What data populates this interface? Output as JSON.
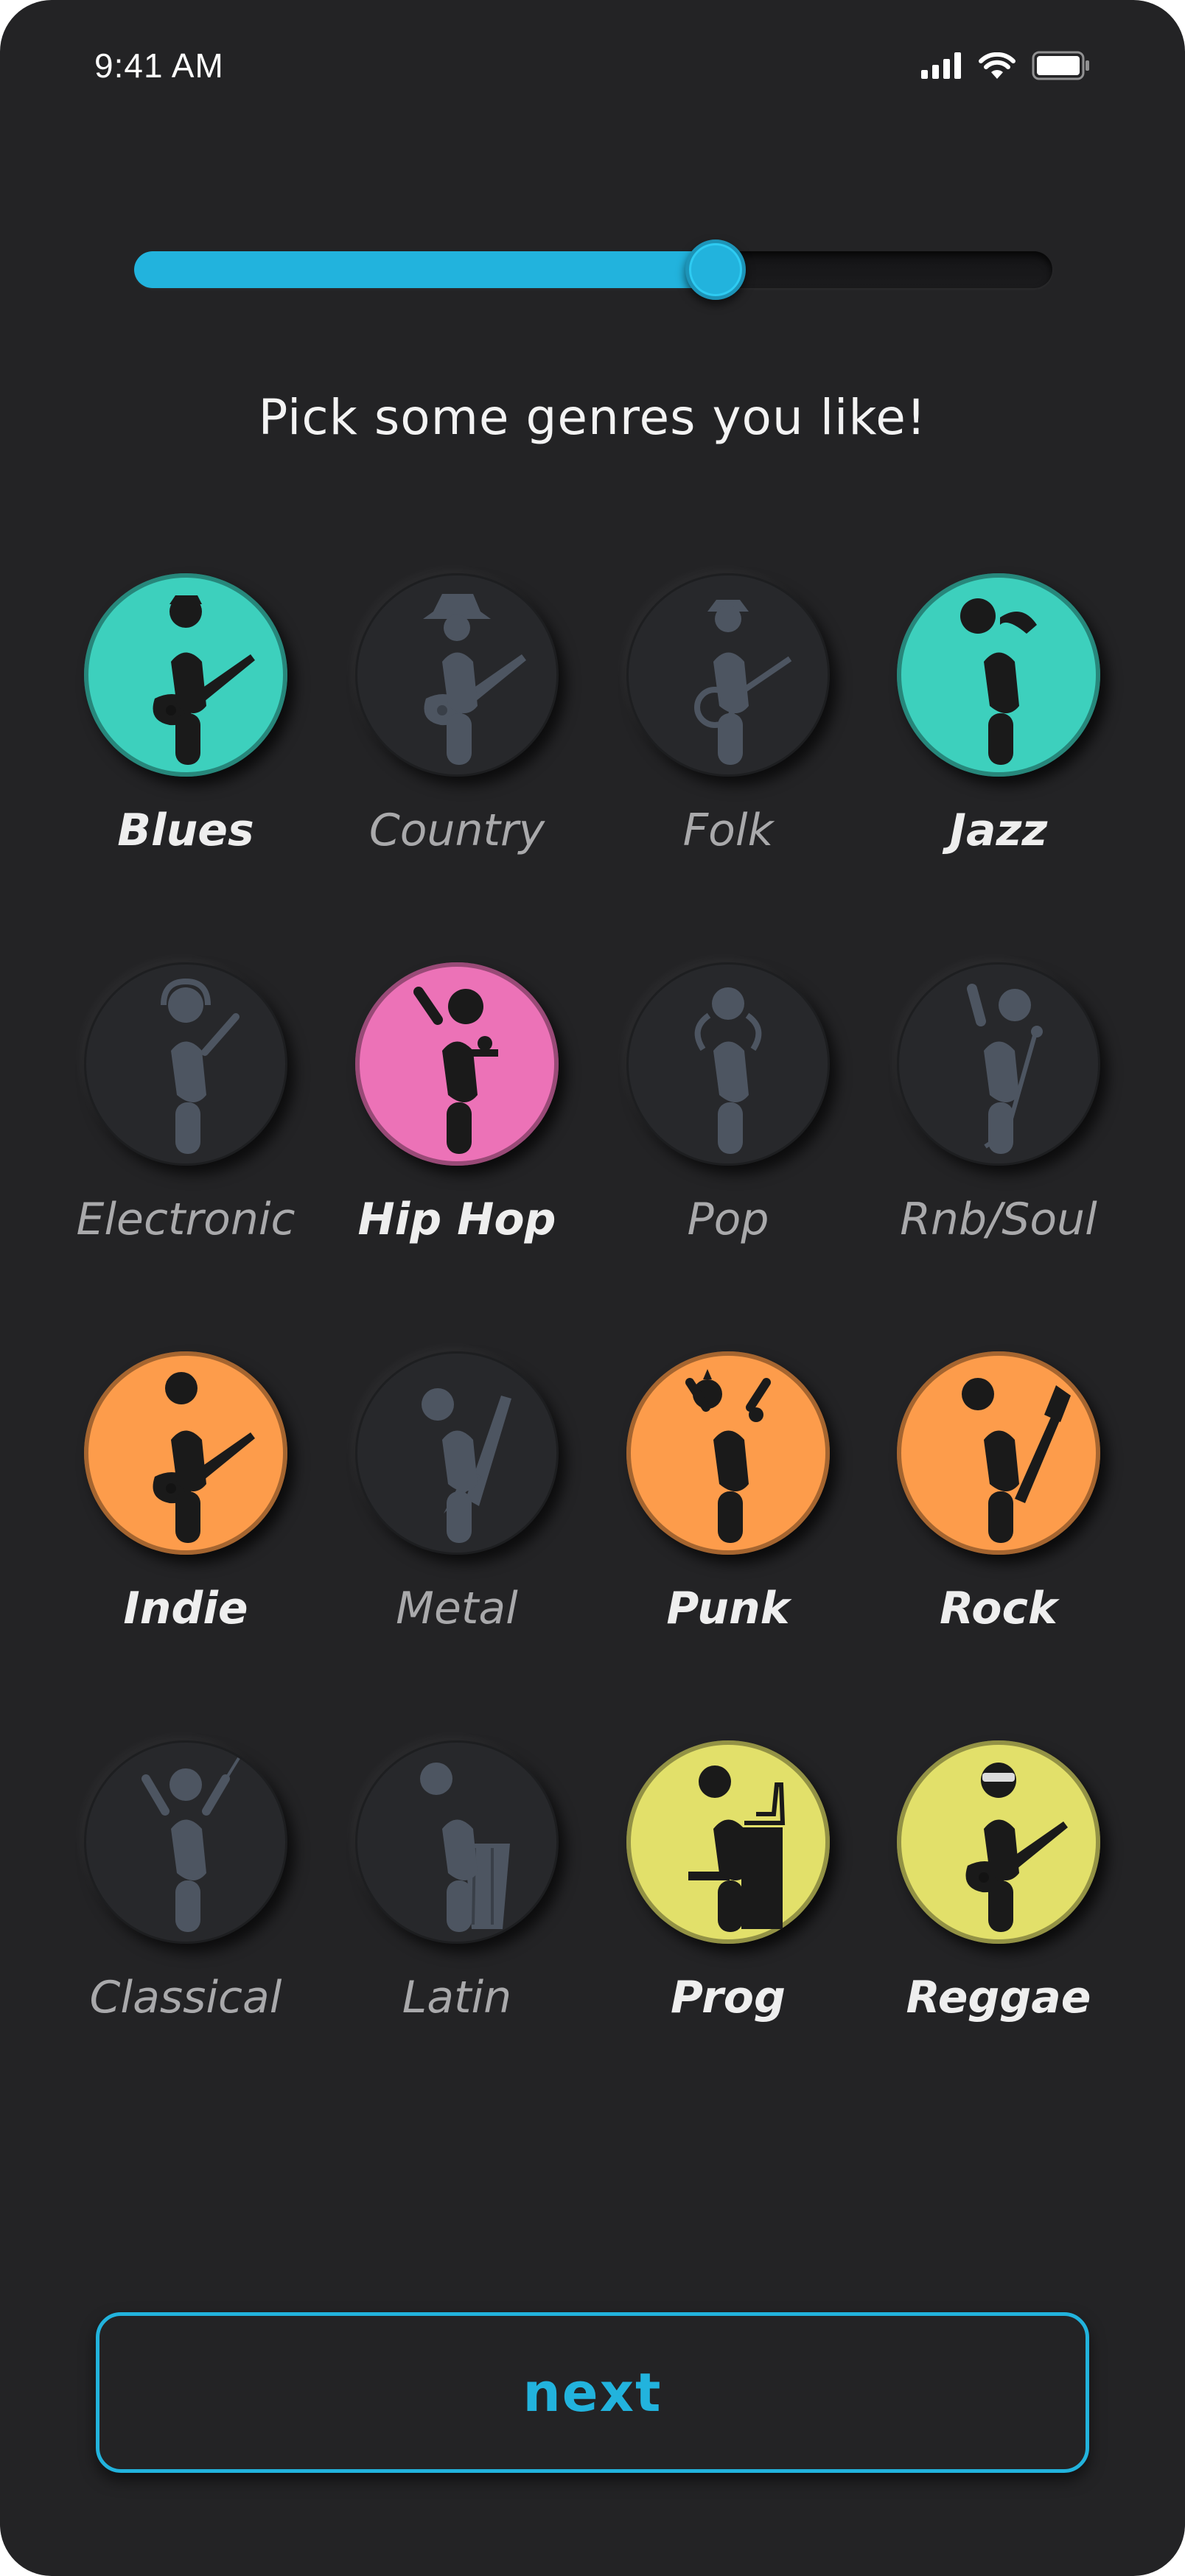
{
  "status_bar": {
    "time": "9:41 AM",
    "icons": [
      "signal-icon",
      "wifi-icon",
      "battery-icon"
    ]
  },
  "progress": {
    "value": 0.64,
    "fill_color": "#22b3dd"
  },
  "heading": "Pick some genres you like!",
  "colors": {
    "teal": "#3dd0bd",
    "pink": "#ec72b7",
    "orange": "#fd9c4b",
    "yellow": "#e2e06a",
    "unselected_figure": "#4d5561",
    "selected_figure": "#1a1a1a",
    "accent": "#22b3dd"
  },
  "genres": [
    {
      "label": "Blues",
      "selected": true,
      "color": "#3dd0bd",
      "icon": "guitarist-icon"
    },
    {
      "label": "Country",
      "selected": false,
      "color": "",
      "icon": "cowboy-guitarist-icon"
    },
    {
      "label": "Folk",
      "selected": false,
      "color": "",
      "icon": "banjo-player-icon"
    },
    {
      "label": "Jazz",
      "selected": true,
      "color": "#3dd0bd",
      "icon": "saxophonist-icon"
    },
    {
      "label": "Electronic",
      "selected": false,
      "color": "",
      "icon": "dj-headphones-icon"
    },
    {
      "label": "Hip Hop",
      "selected": true,
      "color": "#ec72b7",
      "icon": "rapper-icon"
    },
    {
      "label": "Pop",
      "selected": false,
      "color": "",
      "icon": "pop-singer-icon"
    },
    {
      "label": "Rnb/Soul",
      "selected": false,
      "color": "",
      "icon": "mic-stand-singer-icon"
    },
    {
      "label": "Indie",
      "selected": true,
      "color": "#fd9c4b",
      "icon": "indie-guitarist-icon"
    },
    {
      "label": "Metal",
      "selected": false,
      "color": "",
      "icon": "metal-guitarist-icon"
    },
    {
      "label": "Punk",
      "selected": true,
      "color": "#fd9c4b",
      "icon": "punk-singer-icon"
    },
    {
      "label": "Rock",
      "selected": true,
      "color": "#fd9c4b",
      "icon": "rock-guitarist-icon"
    },
    {
      "label": "Classical",
      "selected": false,
      "color": "",
      "icon": "conductor-icon"
    },
    {
      "label": "Latin",
      "selected": false,
      "color": "",
      "icon": "conga-player-icon"
    },
    {
      "label": "Prog",
      "selected": true,
      "color": "#e2e06a",
      "icon": "keyboardist-icon"
    },
    {
      "label": "Reggae",
      "selected": true,
      "color": "#e2e06a",
      "icon": "sunglasses-guitarist-icon"
    }
  ],
  "next_button": {
    "label": "next"
  }
}
